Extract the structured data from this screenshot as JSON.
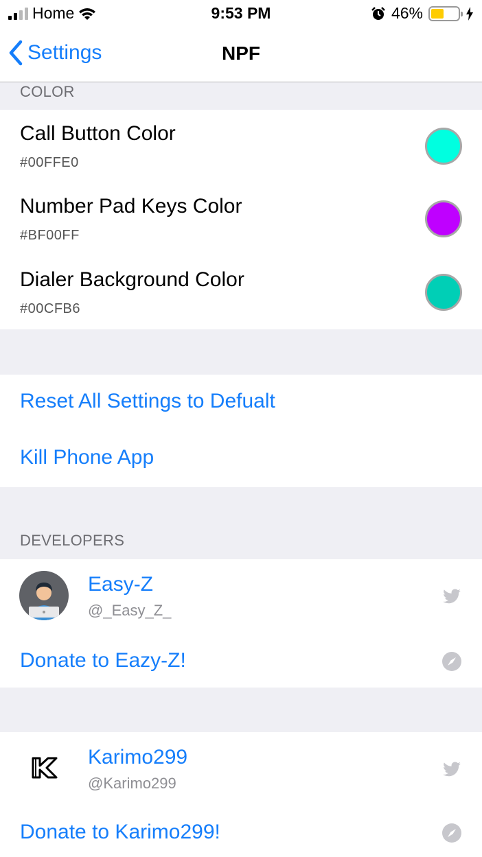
{
  "status_bar": {
    "carrier": "Home",
    "time": "9:53 PM",
    "battery_percent": "46%",
    "battery_level": 0.46,
    "icons": [
      "signal-icon",
      "wifi-icon",
      "alarm-icon",
      "battery-icon",
      "charging-icon"
    ]
  },
  "nav": {
    "back_label": "Settings",
    "title": "NPF"
  },
  "color_section": {
    "header": "COLOR",
    "items": [
      {
        "title": "Call Button Color",
        "value": "#00FFE0",
        "swatch": "#00ffe0"
      },
      {
        "title": "Number Pad Keys Color",
        "value": "#BF00FF",
        "swatch": "#bf00ff"
      },
      {
        "title": "Dialer Background Color",
        "value": "#00CFB6",
        "swatch": "#00cfb6"
      }
    ]
  },
  "actions": {
    "reset_label": "Reset All Settings to Defualt",
    "kill_label": "Kill Phone App"
  },
  "developers_section": {
    "header": "DEVELOPERS",
    "developers": [
      {
        "name": "Easy-Z",
        "handle": "@_Easy_Z_",
        "donate_label": "Donate to Eazy-Z!"
      },
      {
        "name": "Karimo299",
        "handle": "@Karimo299",
        "donate_label": "Donate to Karimo299!"
      }
    ]
  },
  "colors": {
    "accent": "#157efb",
    "background": "#efeff4",
    "header_text": "#6d6d72"
  }
}
